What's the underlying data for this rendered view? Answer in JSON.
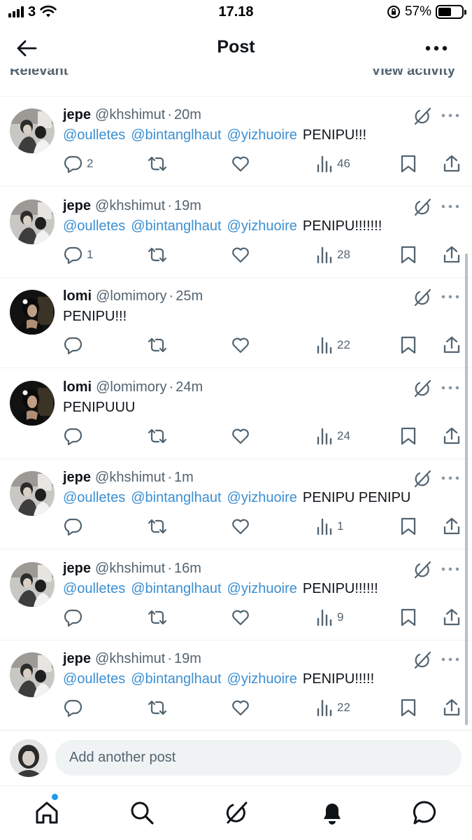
{
  "status_bar": {
    "carrier": "3",
    "time": "17.18",
    "battery": "57%",
    "battery_level": 0.57
  },
  "header": {
    "title": "Post"
  },
  "sort": {
    "left": "Relevant",
    "right": "View activity"
  },
  "replies": [
    {
      "name": "jepe",
      "handle": "@khshimut",
      "sep": "·",
      "time": "20m",
      "mentions": [
        "@oulletes",
        "@bintanglhaut",
        "@yizhuoire"
      ],
      "body": "PENIPU!!!",
      "reply_count": "2",
      "views": "46",
      "avatar": "jepe"
    },
    {
      "name": "jepe",
      "handle": "@khshimut",
      "sep": "·",
      "time": "19m",
      "mentions": [
        "@oulletes",
        "@bintanglhaut",
        "@yizhuoire"
      ],
      "body": "PENIPU!!!!!!!",
      "reply_count": "1",
      "views": "28",
      "avatar": "jepe"
    },
    {
      "name": "lomi",
      "handle": "@lomimory",
      "sep": "·",
      "time": "25m",
      "mentions": [],
      "body": "PENIPU!!!",
      "reply_count": "",
      "views": "22",
      "avatar": "lomi"
    },
    {
      "name": "lomi",
      "handle": "@lomimory",
      "sep": "·",
      "time": "24m",
      "mentions": [],
      "body": "PENIPUUU",
      "reply_count": "",
      "views": "24",
      "avatar": "lomi"
    },
    {
      "name": "jepe",
      "handle": "@khshimut",
      "sep": "·",
      "time": "1m",
      "mentions": [
        "@oulletes",
        "@bintanglhaut",
        "@yizhuoire"
      ],
      "body": "PENIPU PENIPU",
      "reply_count": "",
      "views": "1",
      "avatar": "jepe"
    },
    {
      "name": "jepe",
      "handle": "@khshimut",
      "sep": "·",
      "time": "16m",
      "mentions": [
        "@oulletes",
        "@bintanglhaut",
        "@yizhuoire"
      ],
      "body": "PENIPU!!!!!!",
      "reply_count": "",
      "views": "9",
      "avatar": "jepe"
    },
    {
      "name": "jepe",
      "handle": "@khshimut",
      "sep": "·",
      "time": "19m",
      "mentions": [
        "@oulletes",
        "@bintanglhaut",
        "@yizhuoire"
      ],
      "body": "PENIPU!!!!!",
      "reply_count": "",
      "views": "22",
      "avatar": "jepe"
    }
  ],
  "compose": {
    "placeholder": "Add another post"
  },
  "icons": {
    "back": "arrow-left-icon",
    "more": "more-horizontal-icon",
    "grok": "grok-icon",
    "reply": "reply-icon",
    "repost": "repost-icon",
    "like": "heart-icon",
    "views": "views-icon",
    "bookmark": "bookmark-icon",
    "share": "share-icon",
    "home": "home-icon",
    "search": "search-icon",
    "notifications": "bell-icon",
    "messages": "messages-icon"
  },
  "colors": {
    "mention": "#3b8fd2",
    "muted": "#536471",
    "notification_dot": "#1d9bf0"
  }
}
